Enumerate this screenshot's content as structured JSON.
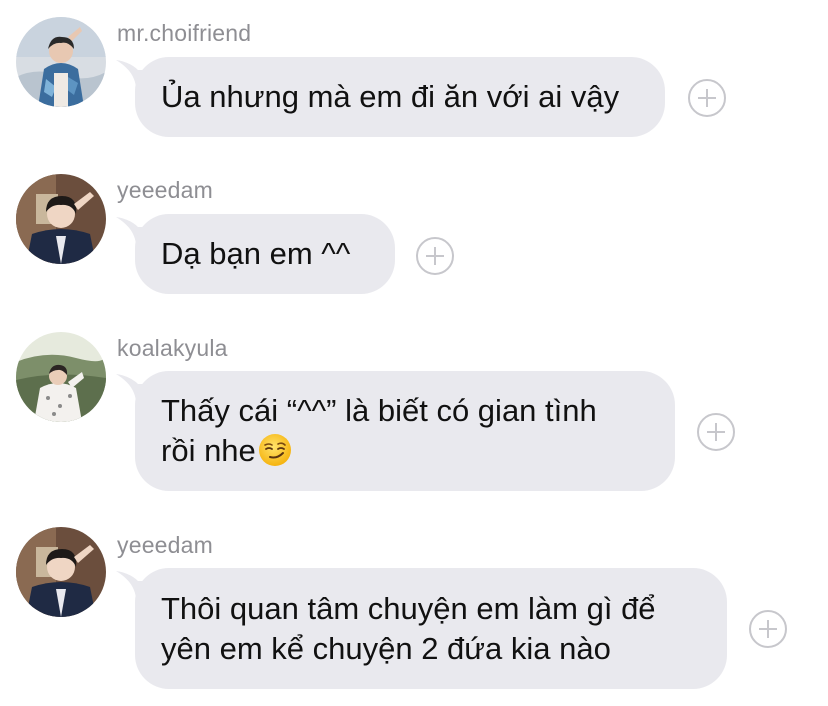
{
  "messages": [
    {
      "username": "mr.choifriend",
      "lines": [
        "Ủa nhưng mà em đi ăn với ai vậy"
      ],
      "avatar_icon": "profile-photo-icon"
    },
    {
      "username": "yeeedam",
      "lines": [
        "Dạ bạn em ^^"
      ],
      "avatar_icon": "profile-photo-icon"
    },
    {
      "username": "koalakyula",
      "lines": [
        "Thấy cái “^^” là biết có gian tình",
        "rồi nhe"
      ],
      "emoji": "smirking-face-emoji",
      "avatar_icon": "profile-photo-icon"
    },
    {
      "username": "yeeedam",
      "lines": [
        "Thôi quan tâm chuyện em làm gì để",
        "yên em kể chuyện 2 đứa kia nào"
      ],
      "avatar_icon": "profile-photo-icon"
    }
  ],
  "colors": {
    "bubble": "#e9e9ee",
    "username": "#8e8e93",
    "text": "#111111",
    "add_icon": "#c7c7cc"
  },
  "icons": {
    "reaction_button": "add-reaction-icon"
  }
}
